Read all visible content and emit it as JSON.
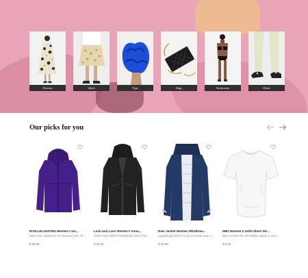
{
  "categories": [
    {
      "label": "Dresses"
    },
    {
      "label": "Skirts"
    },
    {
      "label": "Tops"
    },
    {
      "label": "Bags"
    },
    {
      "label": "Swimwear"
    },
    {
      "label": "Shoes"
    }
  ],
  "picks": {
    "title": "Our picks for you",
    "products": [
      {
        "name": "IDVILLELJUSTEN Women's Ins...",
        "desc": "Note: Size Jackets in UK standard size. Please choose size ac...",
        "price": "$ 56.98"
      },
      {
        "name": "Lock and Love Women's Faux...",
        "desc": "100% POLYURETHANE(shell) 100% POLYESTER(lining) TS...",
        "price": "$ 26.93"
      },
      {
        "name": "Rain Jacket Women Windbrea...",
        "desc": "Lightweight perfet for trip or casual wear; Long sleeve with breatha...",
        "price": "$ 39.99"
      },
      {
        "name": "MBJ Women's Solid Short Sle...",
        "desc": "95% RAYON 5% SPANDEX; Made in USA or Imported; Do N...",
        "price": "$ 9.85"
      }
    ]
  },
  "colors": {
    "hero_bg": "#e8a4b8",
    "label_bg": "#2f2f33"
  }
}
